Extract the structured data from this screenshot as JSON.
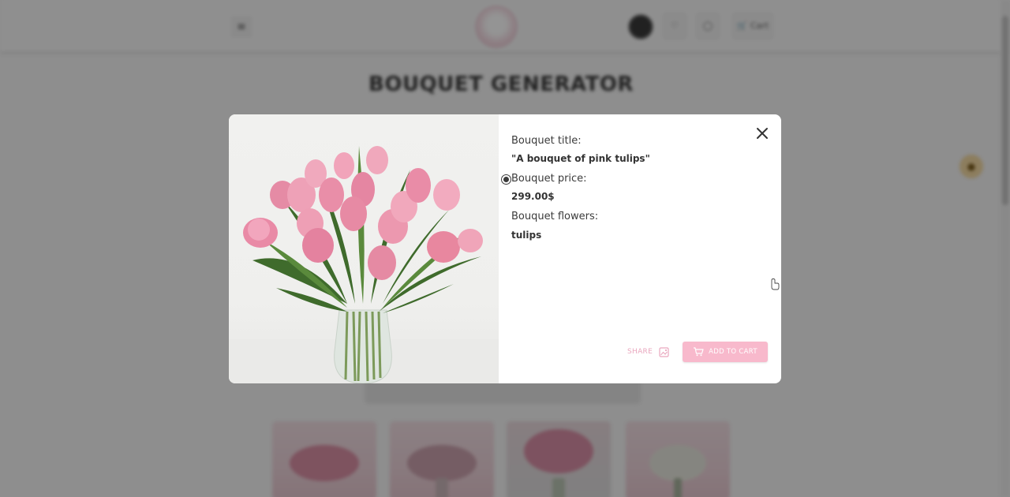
{
  "page": {
    "title": "BOUQUET GENERATOR",
    "header": {
      "menu_icon": "hamburger-icon",
      "logo_icon": "flower-logo-icon",
      "heart_label": "♡",
      "user_label": "◯",
      "cart_label": "🛒 Cart"
    }
  },
  "modal": {
    "title_label": "Bouquet title:",
    "title_value": "\"A bouquet of pink tulips\"",
    "price_label": "Bouquet price:",
    "price_value": "299.00$",
    "flowers_label": "Bouquet flowers:",
    "flowers_value": "tulips",
    "share_label": "SHARE",
    "add_to_cart_label": "ADD TO CART",
    "close_icon": "close-icon"
  },
  "colors": {
    "accent_pink": "#f8b9cc",
    "share_pink": "#e9a7be",
    "overlay": "rgba(0,0,0,0.42)"
  }
}
